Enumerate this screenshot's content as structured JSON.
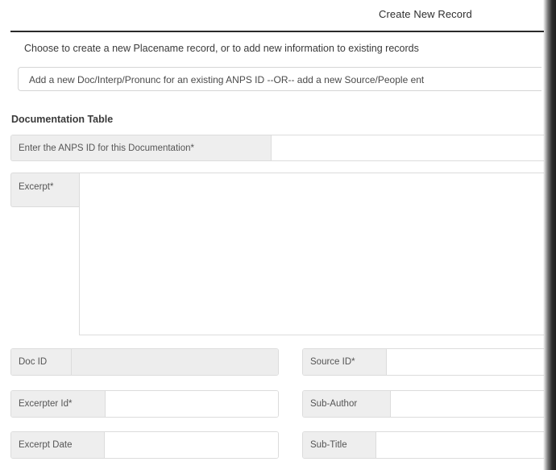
{
  "header": {
    "title": "Create New Record"
  },
  "intro": {
    "text": "Choose to create a new Placename record, or to add new information to existing records"
  },
  "mode_select": {
    "value": "Add a new Doc/Interp/Pronunc for an existing ANPS ID --OR-- add a new Source/People ent"
  },
  "documentation": {
    "section_title": "Documentation Table",
    "anps_id_label": "Enter the ANPS ID for this Documentation*",
    "anps_id_value": "",
    "excerpt_label": "Excerpt*",
    "excerpt_value": "",
    "doc_id_label": "Doc ID",
    "source_id_label": "Source ID*",
    "excerpter_id_label": "Excerpter Id*",
    "sub_author_label": "Sub-Author",
    "excerpt_date_label": "Excerpt Date",
    "sub_title_label": "Sub-Title"
  }
}
